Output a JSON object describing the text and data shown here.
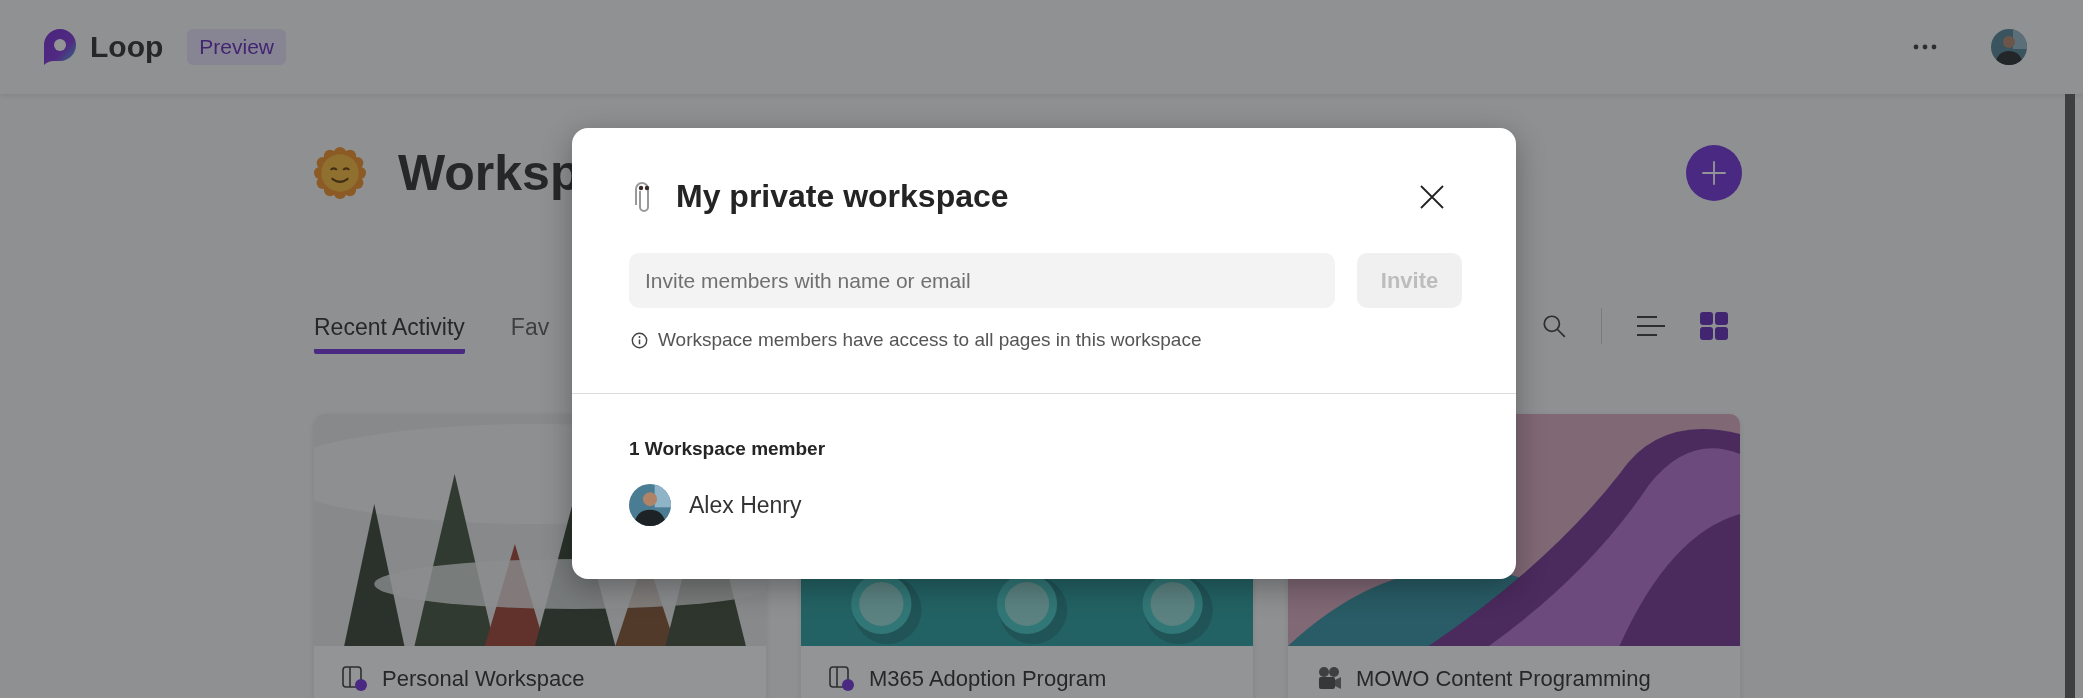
{
  "app": {
    "name": "Loop",
    "badge": "Preview"
  },
  "page": {
    "title": "Worksp",
    "tabs": [
      {
        "label": "Recent Activity",
        "selected": true
      },
      {
        "label": "Fav",
        "selected": false
      }
    ],
    "views": [
      {
        "kind": "list",
        "selected": false
      },
      {
        "kind": "grid",
        "selected": true
      }
    ],
    "cards": [
      {
        "title": "Personal Workspace",
        "kind": "workspace"
      },
      {
        "title": "M365 Adoption Program",
        "kind": "workspace"
      },
      {
        "title": "MOWO Content Programming",
        "kind": "media"
      }
    ]
  },
  "dialog": {
    "title": "My private workspace",
    "invite": {
      "placeholder": "Invite members with name or email",
      "button": "Invite",
      "disabled": true
    },
    "note": "Workspace members have access to all pages in this workspace",
    "members_heading": "1 Workspace member",
    "members": [
      {
        "name": "Alex Henry"
      }
    ]
  }
}
